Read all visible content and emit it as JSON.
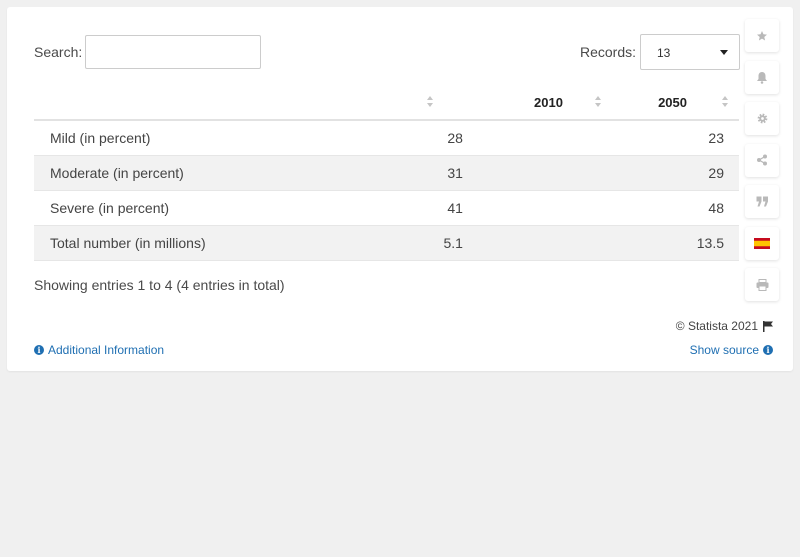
{
  "search": {
    "label": "Search:",
    "value": ""
  },
  "records": {
    "label": "Records:",
    "value": "13"
  },
  "table": {
    "headers": [
      "",
      "2010",
      "2050"
    ],
    "rows": [
      {
        "label": "Mild (in percent)",
        "v2010": "28",
        "v2050": "23"
      },
      {
        "label": "Moderate (in percent)",
        "v2010": "31",
        "v2050": "29"
      },
      {
        "label": "Severe (in percent)",
        "v2010": "41",
        "v2050": "48"
      },
      {
        "label": "Total number (in millions)",
        "v2010": "5.1",
        "v2050": "13.5"
      }
    ]
  },
  "footer": {
    "showing": "Showing entries 1 to 4 (4 entries in total)",
    "copyright": "© Statista 2021",
    "additional_info": "Additional Information",
    "show_source": "Show source"
  },
  "toolbar": {
    "icons": [
      "star-icon",
      "bell-icon",
      "gear-icon",
      "share-icon",
      "quote-icon",
      "spain-flag-icon",
      "print-icon"
    ]
  },
  "colors": {
    "link": "#1f6fb2",
    "icon": "#b9b9b9",
    "stripe": "#f2f2f2"
  }
}
